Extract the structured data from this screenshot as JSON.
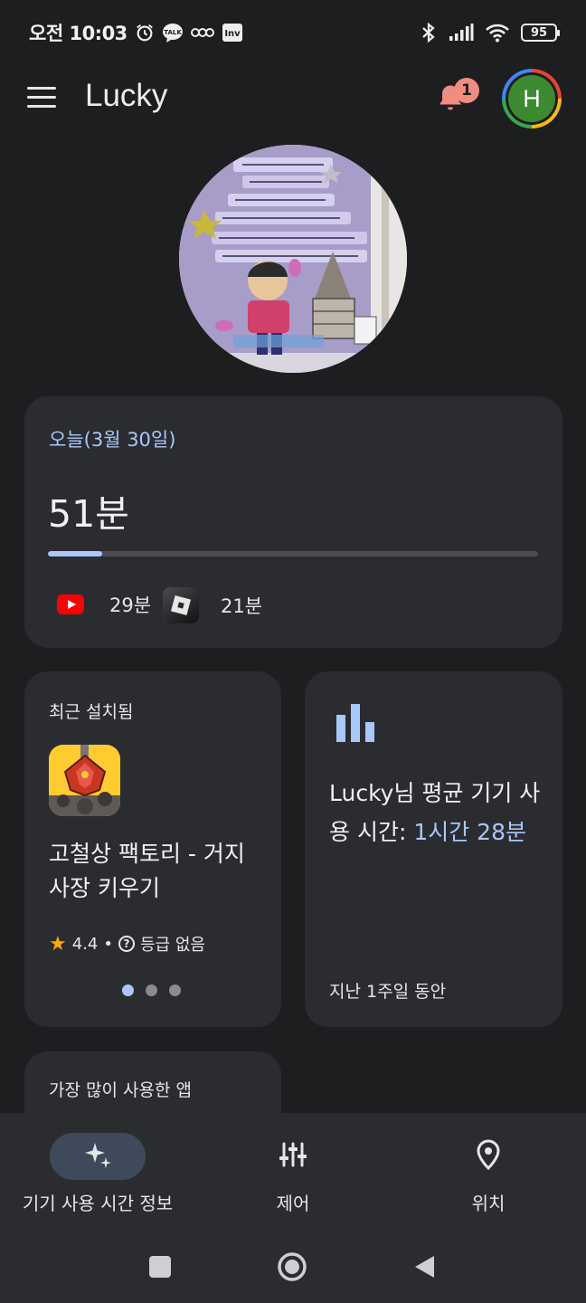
{
  "status_bar": {
    "time": "오전 10:03",
    "battery": "95"
  },
  "app_bar": {
    "title": "Lucky",
    "notification_count": "1",
    "avatar_initial": "H"
  },
  "today": {
    "date_label": "오늘(3월 30일)",
    "total": "51분",
    "progress_fraction": 0.11,
    "apps": [
      {
        "name": "YouTube",
        "icon": "youtube-icon",
        "duration": "29분"
      },
      {
        "name": "Roblox",
        "icon": "roblox-icon",
        "duration": "21분"
      }
    ]
  },
  "recently_installed": {
    "title": "최근 설치됨",
    "app_name": "고철상 팩토리 - 거지 사장 키우기",
    "rating": "4.4",
    "separator": "•",
    "content_rating": "등급 없음",
    "page_count": 3,
    "active_page": 0
  },
  "average": {
    "text_prefix": "Lucky님 평균 기기 사용 시간: ",
    "value": "1시간 28분",
    "period": "지난 1주일 동안"
  },
  "most_used": {
    "title": "가장 많이 사용한 앱"
  },
  "bottom_nav": {
    "items": [
      {
        "label": "기기 사용 시간 정보",
        "icon": "sparkle-icon",
        "active": true
      },
      {
        "label": "제어",
        "icon": "sliders-icon",
        "active": false
      },
      {
        "label": "위치",
        "icon": "location-pin-icon",
        "active": false
      }
    ]
  },
  "colors": {
    "background": "#1d1e20",
    "card": "#2b2c2f",
    "accent": "#a8c7fa",
    "badge": "#f28b82",
    "avatar": "#3c8a2f"
  }
}
